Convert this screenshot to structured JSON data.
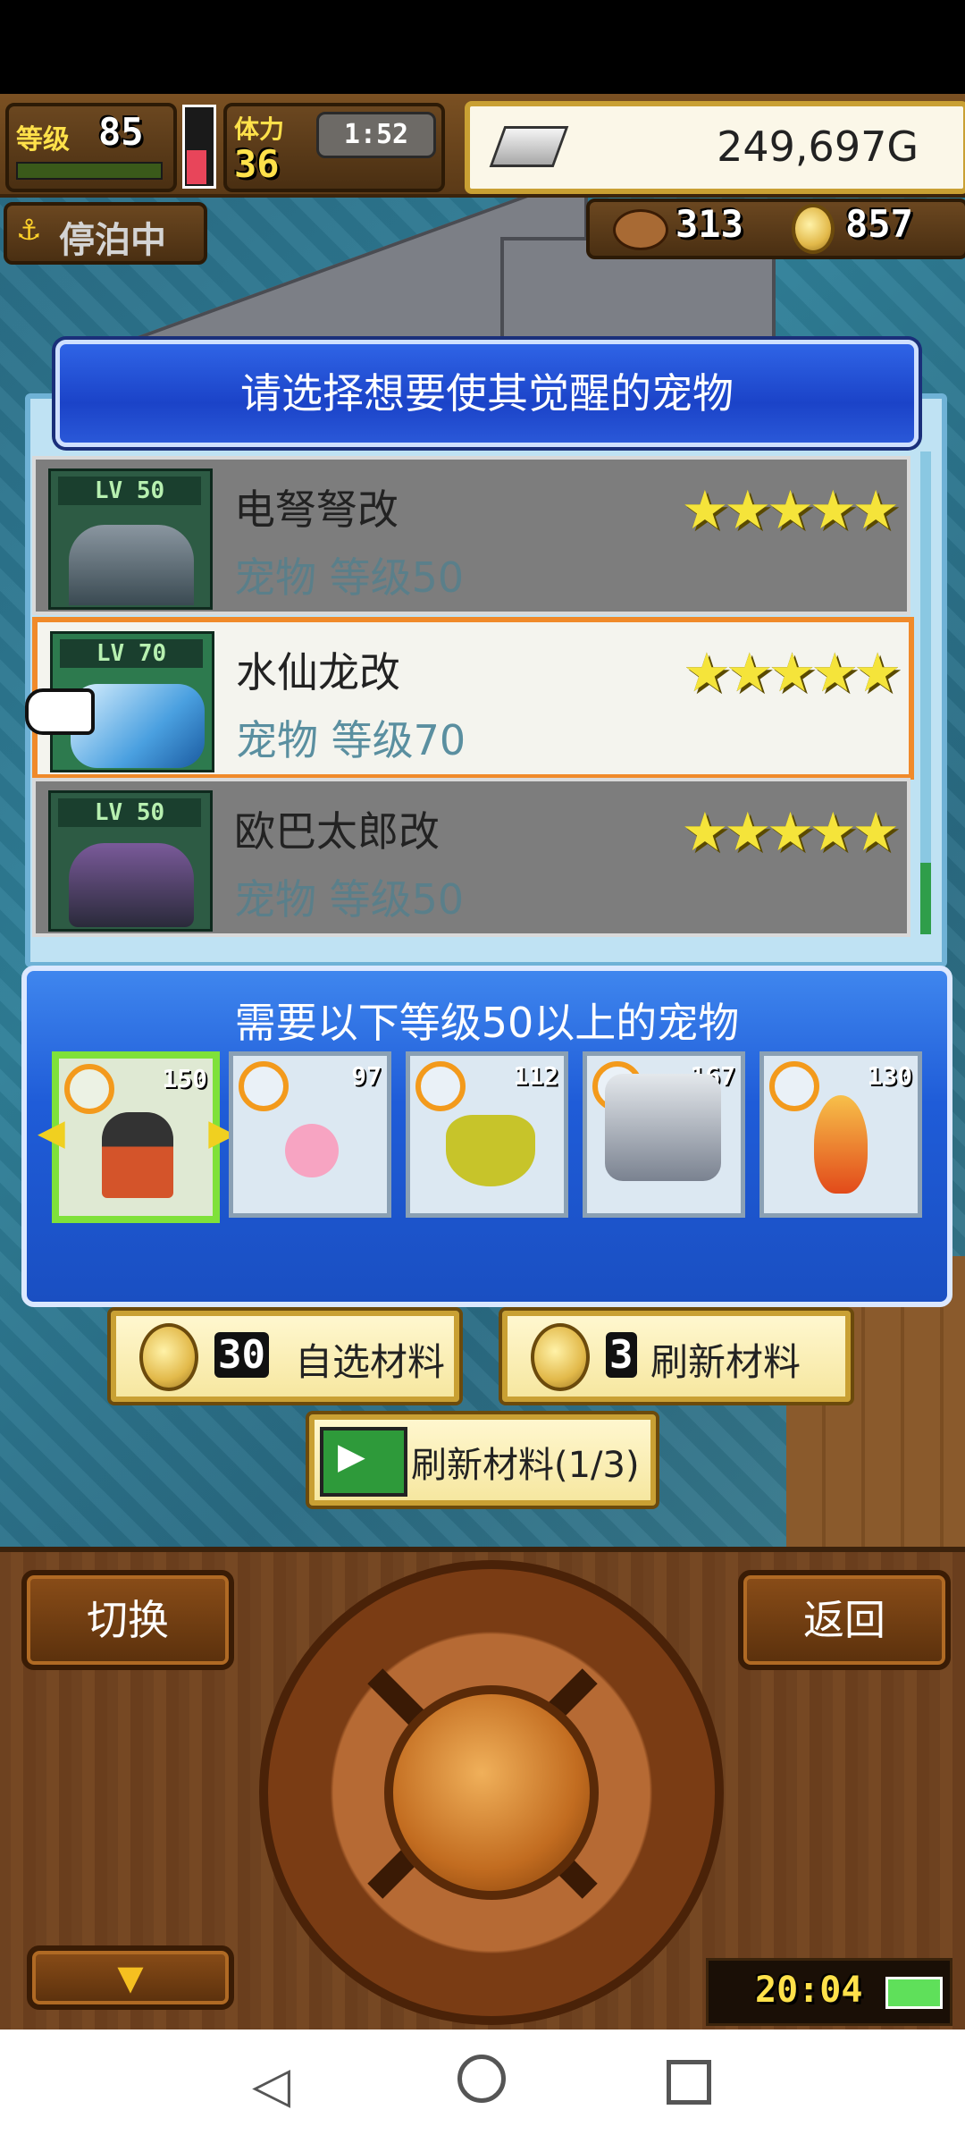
{
  "hud": {
    "level_label": "等级",
    "level_value": "85",
    "stamina_label": "体力",
    "stamina_value": "36",
    "timer": "1:52",
    "gold": "249,697G",
    "docked_label": "停泊中",
    "resource_a": "313",
    "resource_b": "857"
  },
  "dialog": {
    "title": "请选择想要使其觉醒的宠物",
    "pets": [
      {
        "name": "电弩弩改",
        "sub": "宠物 等级50",
        "lv_badge": "LV 50",
        "stars": "★★★★★"
      },
      {
        "name": "水仙龙改",
        "sub": "宠物 等级70",
        "lv_badge": "LV 70",
        "stars": "★★★★★"
      },
      {
        "name": "欧巴太郎改",
        "sub": "宠物 等级50",
        "lv_badge": "LV 50",
        "stars": "★★★★★"
      }
    ]
  },
  "requirement": {
    "title": "需要以下等级50以上的宠物",
    "slots": [
      {
        "num": "150"
      },
      {
        "num": "97"
      },
      {
        "num": "112"
      },
      {
        "num": "167"
      },
      {
        "num": "130"
      }
    ]
  },
  "buttons": {
    "choose_cost": "30",
    "choose_label": "自选材料",
    "refresh_cost": "3",
    "refresh_label": "刷新材料",
    "video_refresh_label": "刷新材料(1/3)"
  },
  "controls": {
    "switch_label": "切换",
    "back_label": "返回",
    "clock": "20:04"
  },
  "colors": {
    "dialog_blue": "#1b43c8",
    "selected_border": "#f08a2a",
    "star": "#f5e43a",
    "active_slot": "#7fe13a"
  }
}
